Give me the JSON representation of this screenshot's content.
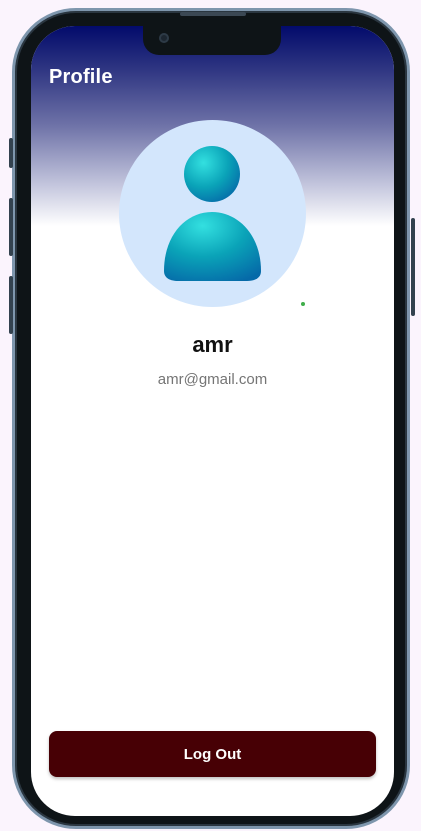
{
  "header": {
    "title": "Profile"
  },
  "profile": {
    "avatar_icon": "user-avatar-icon",
    "name": "amr",
    "email": "amr@gmail.com",
    "status": "online"
  },
  "actions": {
    "logout_label": "Log Out"
  },
  "colors": {
    "header_gradient_top": "#020a6b",
    "avatar_background": "#d3e6fc",
    "avatar_figure": "#0aa3b8",
    "logout_button": "#470005",
    "status_dot": "#3fae4a",
    "email_text": "#757575"
  }
}
